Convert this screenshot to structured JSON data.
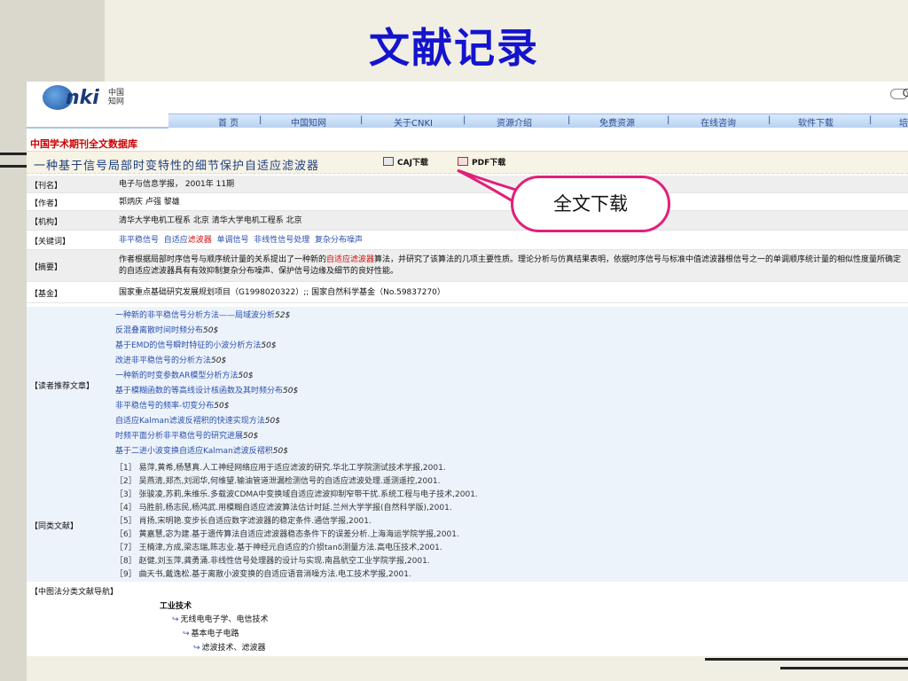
{
  "slide": {
    "title": "文献记录"
  },
  "header": {
    "logo_text": "nki",
    "logo_cn_1": "中国",
    "logo_cn_2": "知网",
    "corner_char": "C"
  },
  "nav": {
    "items": [
      "首 页",
      "中国知网",
      "关于CNKI",
      "资源介绍",
      "免费资源",
      "在线咨询",
      "软件下载",
      "培"
    ],
    "separator": "|"
  },
  "database_title": "中国学术期刊全文数据库",
  "paper": {
    "title": "一种基于信号局部时变特性的细节保护自适应滤波器",
    "caj_label": "CAJ下载",
    "pdf_label": "PDF下载"
  },
  "fields": {
    "journal": {
      "label": "【刊名】",
      "value": "电子与信息学报， 2001年 11期"
    },
    "author": {
      "label": "【作者】",
      "value": "郭炳庆 卢强 黎雄"
    },
    "org": {
      "label": "【机构】",
      "value": "清华大学电机工程系 北京 清华大学电机工程系 北京"
    },
    "keywords": {
      "label": "【关键词】",
      "k1": "非平稳信号",
      "k2a": "自适应",
      "k2b": "滤波器",
      "k3": "单调信号",
      "k4": "非线性信号处理",
      "k5": "复杂分布噪声"
    },
    "abstract": {
      "label": "【摘要】",
      "part1": "作者根据局部时序信号与顺序统计量的关系提出了一种新的",
      "highlight": "自适应滤波器",
      "part2": "算法，并研究了该算法的几项主要性质。理论分析与仿真结果表明，依据时序信号与标准中值滤波器根信号之一的单调顺序统计量的相似性度量所确定的自适应滤波器具有有效抑制复杂分布噪声、保护信号边缘及细节的良好性能。"
    },
    "fund": {
      "label": "【基金】",
      "value": "国家重点基础研究发展规划项目（G1998020322）;; 国家自然科学基金（No.59837270）"
    }
  },
  "recommended": {
    "label": "【读者推荐文章】",
    "items": [
      {
        "title": "一种新的非平稳信号分析方法——局域波分析",
        "count": "52$"
      },
      {
        "title": "反混叠离散时间时频分布",
        "count": "50$"
      },
      {
        "title": "基于EMD的信号瞬时特征的小波分析方法",
        "count": "50$"
      },
      {
        "title": "改进非平稳信号的分析方法",
        "count": "50$"
      },
      {
        "title": "一种新的时变参数AR模型分析方法",
        "count": "50$"
      },
      {
        "title": "基于模糊函数的等高线设计核函数及其时频分布",
        "count": "50$"
      },
      {
        "title": "非平稳信号的频率-切变分布",
        "count": "50$"
      },
      {
        "title": "自适应Kalman滤波反褶积的快速实现方法",
        "count": "50$"
      },
      {
        "title": "时频平面分析非平稳信号的研究进展",
        "count": "50$"
      },
      {
        "title": "基于二进小波变换自适应Kalman滤波反褶积",
        "count": "50$"
      }
    ]
  },
  "similar": {
    "label": "【同类文献】",
    "items": [
      "［1］ 易萍,黄希,杨慧真.人工神经网络应用于适应滤波的研究.华北工学院测试技术学报,2001.",
      "［2］ 吴燕清,郑杰,刘润华,何维望.输油管道泄漏检测信号的自适应滤波处理.遥测遥控,2001.",
      "［3］ 张骏凌,苏莉,朱维乐.多载波CDMA中变换域自适应滤波抑制窄带干扰.系统工程与电子技术,2001.",
      "［4］ 马胜前,杨志民,杨鸿武.用模糊自适应滤波算法估计时延.兰州大学学报(自然科学版),2001.",
      "［5］ 肖扬,宋明艳.变步长自适应数字滤波器的稳定条件.通信学报,2001.",
      "［6］ 黄嘉慧,宓为建.基于遗传算法自适应滤波器稳态条件下的误差分析.上海海运学院学报,2001.",
      "［7］ 王楠津,方成,梁志瑞,陈志业.基于神经元自适应的介损tanδ测量方法.高电压技术,2001.",
      "［8］ 赵健,刘玉萍,龚勇涌.非线性信号处理器的设计与实现.南昌航空工业学院学报,2001.",
      "［9］ 曲天书,戴逸松.基于离散小波变换的自适应语音消噪方法.电工技术学报,2001."
    ]
  },
  "classification": {
    "label": "【中图法分类文献导航】",
    "root": "工业技术",
    "level1": "无线电电子学、电信技术",
    "level2": "基本电子电路",
    "level3": "滤波技术、滤波器"
  },
  "callout": {
    "text": "全文下载",
    "border_color": "#e0207a"
  }
}
